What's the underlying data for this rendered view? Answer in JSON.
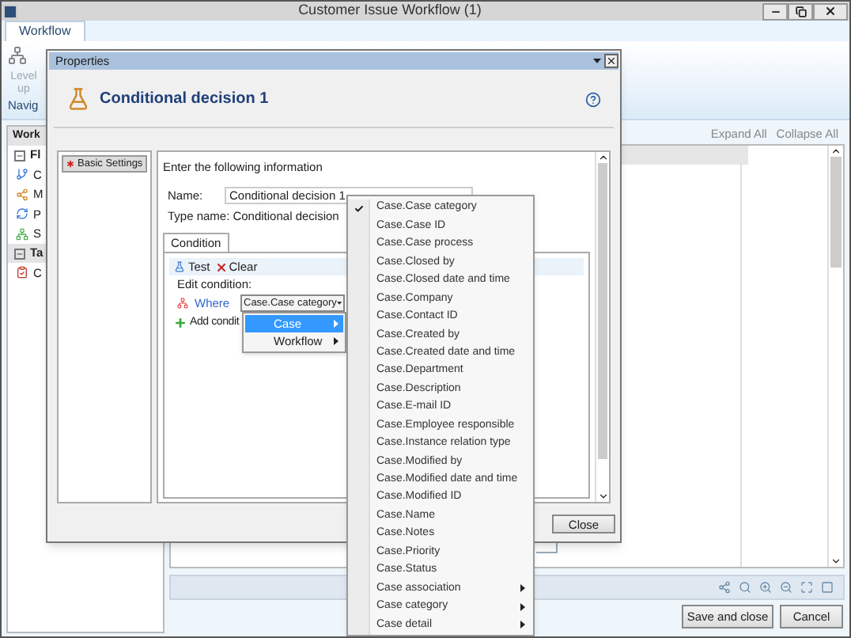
{
  "window": {
    "title": "Customer Issue Workflow (1)"
  },
  "ribbon": {
    "tabs": [
      {
        "label": "Workflow",
        "selected": true
      }
    ],
    "button": "Level up",
    "group_label": "Navig"
  },
  "left_panel": {
    "header": "Work",
    "groups": [
      {
        "label": "Fl",
        "expanded": true,
        "items": [
          "C",
          "M",
          "P",
          "S"
        ]
      },
      {
        "label": "Ta",
        "expanded": true,
        "items": [
          "C"
        ]
      }
    ]
  },
  "canvas": {
    "links": [
      "Expand All",
      "Collapse All"
    ]
  },
  "buttons": [
    "Save and close",
    "Cancel"
  ],
  "dialog": {
    "title": "Properties",
    "heading": "Conditional decision 1",
    "nav": [
      {
        "label": "Basic Settings",
        "selected": true
      }
    ],
    "intro": "Enter the following information",
    "fields": [
      {
        "kind": "input",
        "label": "Name:",
        "value": "Conditional decision 1"
      },
      {
        "kind": "text",
        "label": "Type name:",
        "value": "Conditional decision"
      }
    ],
    "tabs": [
      {
        "label": "Condition",
        "selected": true
      }
    ],
    "actions": [
      "Test",
      "Clear"
    ],
    "edit_label": "Edit condition:",
    "where_label": "Where",
    "condition_value": "Case.Case category",
    "add_label": "Add condit",
    "close": "Close"
  },
  "submenu": [
    {
      "label": "Case",
      "selected": true,
      "has_children": true
    },
    {
      "label": "Workflow",
      "selected": false,
      "has_children": true
    }
  ],
  "field_menu": [
    {
      "label": "Case.Case category",
      "checked": true,
      "has_children": false
    },
    {
      "label": "Case.Case ID",
      "checked": false,
      "has_children": false
    },
    {
      "label": "Case.Case process",
      "checked": false,
      "has_children": false
    },
    {
      "label": "Case.Closed by",
      "checked": false,
      "has_children": false
    },
    {
      "label": "Case.Closed date and time",
      "checked": false,
      "has_children": false
    },
    {
      "label": "Case.Company",
      "checked": false,
      "has_children": false
    },
    {
      "label": "Case.Contact ID",
      "checked": false,
      "has_children": false
    },
    {
      "label": "Case.Created by",
      "checked": false,
      "has_children": false
    },
    {
      "label": "Case.Created date and time",
      "checked": false,
      "has_children": false
    },
    {
      "label": "Case.Department",
      "checked": false,
      "has_children": false
    },
    {
      "label": "Case.Description",
      "checked": false,
      "has_children": false
    },
    {
      "label": "Case.E-mail ID",
      "checked": false,
      "has_children": false
    },
    {
      "label": "Case.Employee responsible",
      "checked": false,
      "has_children": false
    },
    {
      "label": "Case.Instance relation type",
      "checked": false,
      "has_children": false
    },
    {
      "label": "Case.Modified by",
      "checked": false,
      "has_children": false
    },
    {
      "label": "Case.Modified date and time",
      "checked": false,
      "has_children": false
    },
    {
      "label": "Case.Modified ID",
      "checked": false,
      "has_children": false
    },
    {
      "label": "Case.Name",
      "checked": false,
      "has_children": false
    },
    {
      "label": "Case.Notes",
      "checked": false,
      "has_children": false
    },
    {
      "label": "Case.Priority",
      "checked": false,
      "has_children": false
    },
    {
      "label": "Case.Status",
      "checked": false,
      "has_children": false
    },
    {
      "label": "Case association",
      "checked": false,
      "has_children": true
    },
    {
      "label": "Case category",
      "checked": false,
      "has_children": true
    },
    {
      "label": "Case detail",
      "checked": false,
      "has_children": true
    }
  ]
}
